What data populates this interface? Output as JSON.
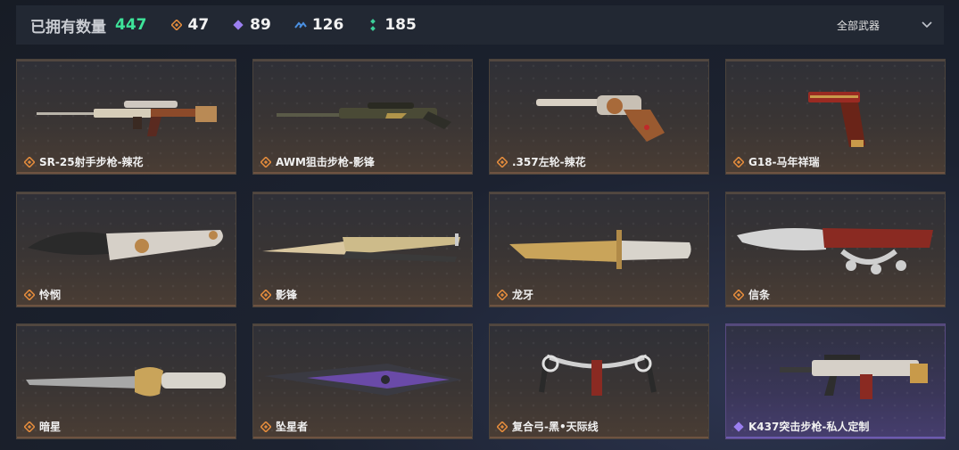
{
  "header": {
    "title": "已拥有数量",
    "total": "447",
    "stats": [
      {
        "tier": "orange",
        "icon": "orange-diamond-icon",
        "count": "47"
      },
      {
        "tier": "purple",
        "icon": "purple-diamond-icon",
        "count": "89"
      },
      {
        "tier": "blue",
        "icon": "blue-chevron-icon",
        "count": "126"
      },
      {
        "tier": "green",
        "icon": "green-dots-icon",
        "count": "185"
      }
    ],
    "filter_label": "全部武器"
  },
  "colors": {
    "accent_green": "#3ee49a",
    "orange": "#e08a3c",
    "purple": "#9b7ff0",
    "blue": "#4a90e2",
    "green": "#3ccf9a"
  },
  "weapons": [
    {
      "name": "SR-25射手步枪-辣花",
      "tier": "orange"
    },
    {
      "name": "AWM狙击步枪-影锋",
      "tier": "orange"
    },
    {
      "name": ".357左轮-辣花",
      "tier": "orange"
    },
    {
      "name": "G18-马年祥瑞",
      "tier": "orange"
    },
    {
      "name": "怜悯",
      "tier": "orange"
    },
    {
      "name": "影锋",
      "tier": "orange"
    },
    {
      "name": "龙牙",
      "tier": "orange"
    },
    {
      "name": "信条",
      "tier": "orange"
    },
    {
      "name": "暗星",
      "tier": "orange"
    },
    {
      "name": "坠星者",
      "tier": "orange"
    },
    {
      "name": "复合弓-黑•天际线",
      "tier": "orange"
    },
    {
      "name": "K437突击步枪-私人定制",
      "tier": "purple"
    }
  ]
}
